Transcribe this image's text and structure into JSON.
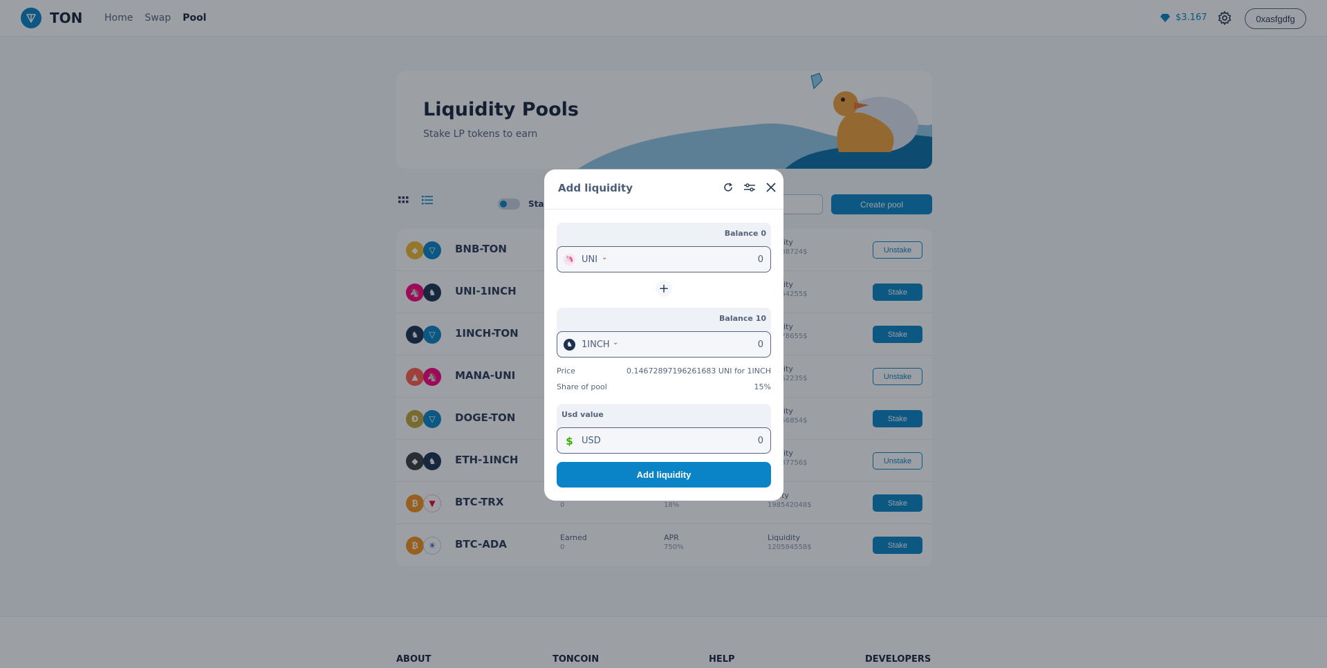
{
  "header": {
    "logo": "TON",
    "nav": [
      "Home",
      "Swap",
      "Pool"
    ],
    "active_nav": "Pool",
    "price": "$3.167",
    "wallet": "0xasfgdfg"
  },
  "hero": {
    "title": "Liquidity Pools",
    "subtitle": "Stake LP tokens to earn"
  },
  "toolbar": {
    "toggle_label": "Stak",
    "create_pool": "Create pool"
  },
  "pools": [
    {
      "name": "BNB-TON",
      "liq_label": "idity",
      "liquidity": "288724$",
      "action": "Unstake",
      "coins": [
        "bnb-icon",
        "ton-icon"
      ]
    },
    {
      "name": "UNI-1INCH",
      "liq_label": "idity",
      "liquidity": "464255$",
      "action": "Stake",
      "coins": [
        "uni-icon",
        "1inch-icon"
      ]
    },
    {
      "name": "1INCH-TON",
      "liq_label": "idity",
      "liquidity": "578655$",
      "action": "Stake",
      "coins": [
        "1inch-icon",
        "ton-icon"
      ]
    },
    {
      "name": "MANA-UNI",
      "liq_label": "idity",
      "liquidity": "962235$",
      "action": "Unstake",
      "coins": [
        "mana-icon",
        "uni-icon"
      ]
    },
    {
      "name": "DOGE-TON",
      "liq_label": "idity",
      "liquidity": "256854$",
      "action": "Stake",
      "coins": [
        "doge-icon",
        "ton-icon"
      ]
    },
    {
      "name": "ETH-1INCH",
      "liq_label": "idity",
      "liquidity": "587756$",
      "action": "Unstake",
      "coins": [
        "eth-icon",
        "1inch-icon"
      ]
    },
    {
      "name": "BTC-TRX",
      "earned_value": "0",
      "apr_value": "18%",
      "liq_label": "uidity",
      "liquidity": "198542048$",
      "action": "Stake",
      "coins": [
        "btc-icon",
        "trx-icon"
      ]
    },
    {
      "name": "BTC-ADA",
      "earned_label": "Earned",
      "earned_value": "0",
      "apr_label": "APR",
      "apr_value": "750%",
      "liq_label": "Liquidity",
      "liquidity": "120584558$",
      "action": "Stake",
      "coins": [
        "btc-icon",
        "ada-icon"
      ]
    }
  ],
  "footer": [
    "ABOUT",
    "TONCOIN",
    "HELP",
    "DEVELOPERS"
  ],
  "modal": {
    "title": "Add liquidity",
    "token1": {
      "balance": "Balance 0",
      "symbol": "UNI",
      "amount": "0"
    },
    "token2": {
      "balance": "Balance 10",
      "symbol": "1INCH",
      "amount": "0"
    },
    "price_label": "Price",
    "price_value": "0.14672897196261683 UNI for 1INCH",
    "share_label": "Share of pool",
    "share_value": "15%",
    "usd_label": "Usd value",
    "usd_symbol": "USD",
    "usd_amount": "0",
    "submit": "Add liquidity"
  },
  "colors": {
    "accent": "#0a84c6",
    "text": "#2a3a55",
    "overlay": "rgba(20,26,38,0.42)"
  }
}
